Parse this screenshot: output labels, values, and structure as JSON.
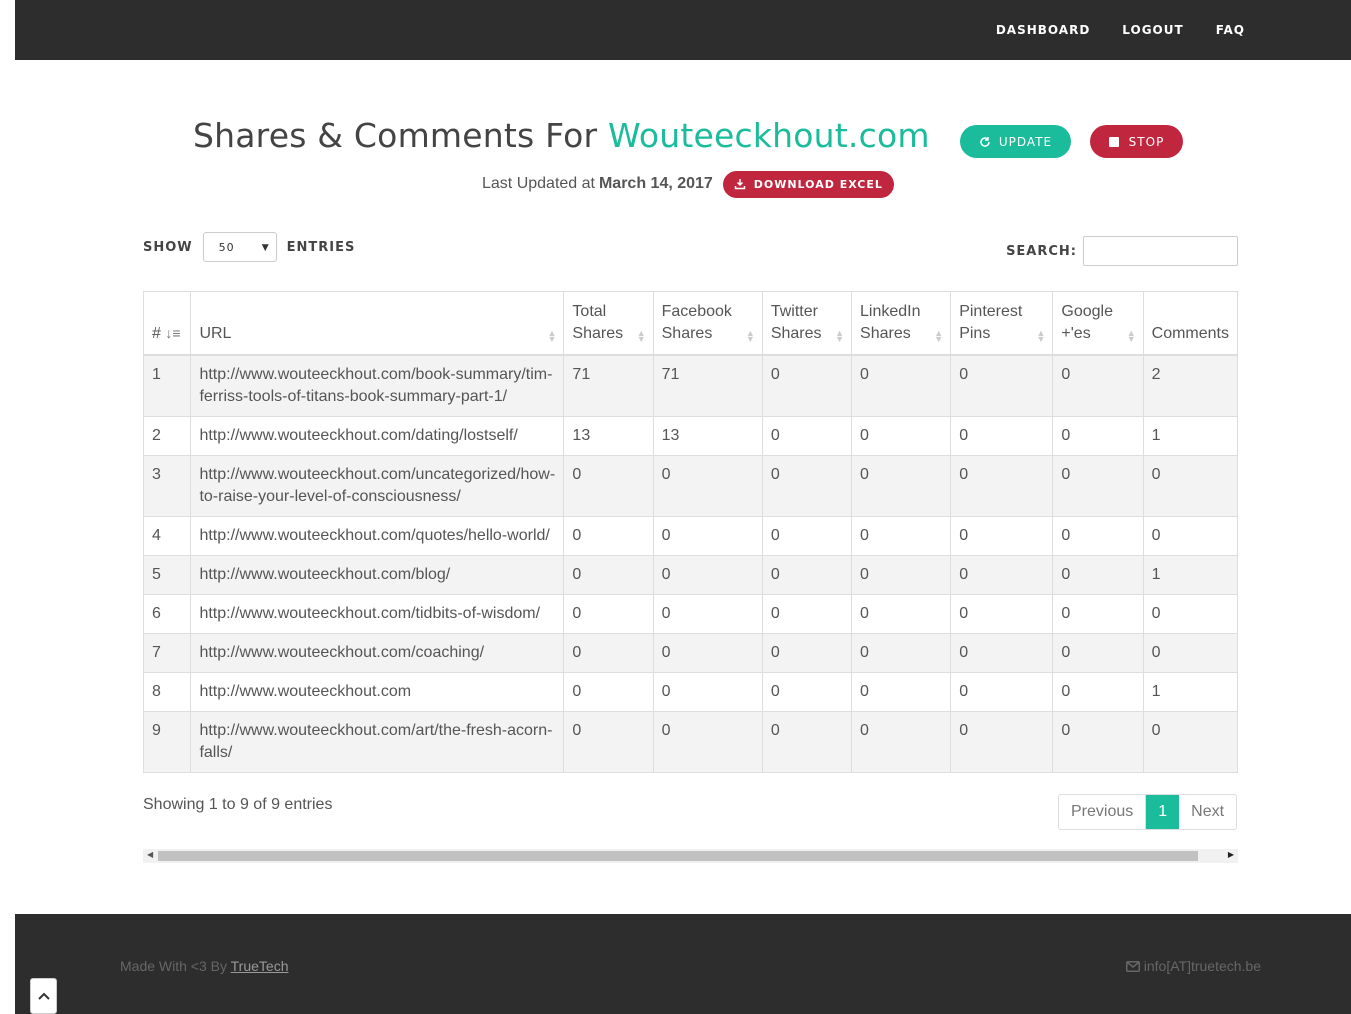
{
  "nav": {
    "dashboard": "DASHBOARD",
    "logout": "LOGOUT",
    "faq": "FAQ"
  },
  "header": {
    "title_prefix": "Shares & Comments For",
    "site": "Wouteeckhout.com",
    "update_label": "UPDATE",
    "stop_label": "STOP",
    "last_updated_label": "Last Updated at",
    "last_updated_date": "March 14, 2017",
    "download_label": "DOWNLOAD EXCEL"
  },
  "controls": {
    "show_label": "SHOW",
    "entries_value": "50",
    "entries_label": "ENTRIES",
    "search_label": "SEARCH:",
    "search_value": ""
  },
  "table": {
    "columns": [
      "#",
      "URL",
      "Total Shares",
      "Facebook Shares",
      "Twitter Shares",
      "LinkedIn Shares",
      "Pinterest Pins",
      "Google +'es",
      "Comments"
    ],
    "rows": [
      [
        "1",
        "http://www.wouteeckhout.com/book-summary/tim-ferriss-tools-of-titans-book-summary-part-1/",
        "71",
        "71",
        "0",
        "0",
        "0",
        "0",
        "2"
      ],
      [
        "2",
        "http://www.wouteeckhout.com/dating/lostself/",
        "13",
        "13",
        "0",
        "0",
        "0",
        "0",
        "1"
      ],
      [
        "3",
        "http://www.wouteeckhout.com/uncategorized/how-to-raise-your-level-of-consciousness/",
        "0",
        "0",
        "0",
        "0",
        "0",
        "0",
        "0"
      ],
      [
        "4",
        "http://www.wouteeckhout.com/quotes/hello-world/",
        "0",
        "0",
        "0",
        "0",
        "0",
        "0",
        "0"
      ],
      [
        "5",
        "http://www.wouteeckhout.com/blog/",
        "0",
        "0",
        "0",
        "0",
        "0",
        "0",
        "1"
      ],
      [
        "6",
        "http://www.wouteeckhout.com/tidbits-of-wisdom/",
        "0",
        "0",
        "0",
        "0",
        "0",
        "0",
        "0"
      ],
      [
        "7",
        "http://www.wouteeckhout.com/coaching/",
        "0",
        "0",
        "0",
        "0",
        "0",
        "0",
        "0"
      ],
      [
        "8",
        "http://www.wouteeckhout.com",
        "0",
        "0",
        "0",
        "0",
        "0",
        "0",
        "1"
      ],
      [
        "9",
        "http://www.wouteeckhout.com/art/the-fresh-acorn-falls/",
        "0",
        "0",
        "0",
        "0",
        "0",
        "0",
        "0"
      ]
    ]
  },
  "pagination": {
    "info": "Showing 1 to 9 of 9 entries",
    "previous": "Previous",
    "current": "1",
    "next": "Next"
  },
  "footer": {
    "made_prefix": "Made With <3 By",
    "made_link": "TrueTech",
    "email": "info[AT]truetech.be"
  },
  "colors": {
    "accent": "#1abc9c",
    "danger": "#c0263e",
    "dark": "#2d2d2d"
  }
}
